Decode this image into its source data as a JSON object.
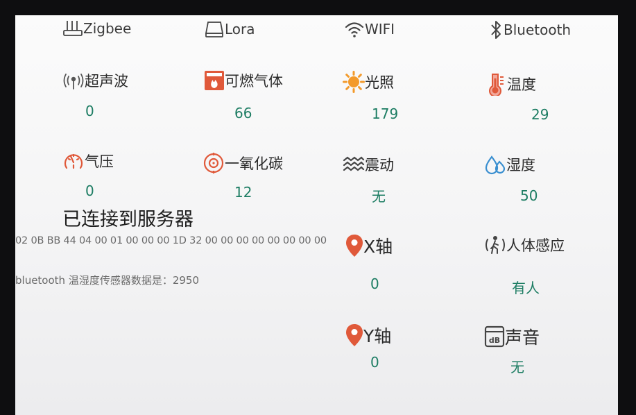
{
  "colors": {
    "accent_value": "#1d7d63",
    "icon_red": "#e0593a",
    "icon_orange": "#f39a2b",
    "icon_blue": "#3a8fd0",
    "icon_gray": "#444444"
  },
  "connectivity": {
    "zigbee": {
      "label": "Zigbee",
      "icon": "router-icon"
    },
    "lora": {
      "label": "Lora",
      "icon": "device-icon"
    },
    "wifi": {
      "label": "WIFI",
      "icon": "wifi-icon"
    },
    "bluetooth": {
      "label": "Bluetooth",
      "icon": "bluetooth-icon"
    }
  },
  "sensors": {
    "ultrasonic": {
      "label": "超声波",
      "value": "0",
      "icon": "signal-icon"
    },
    "gas": {
      "label": "可燃气体",
      "value": "66",
      "icon": "flame-icon"
    },
    "light": {
      "label": "光照",
      "value": "179",
      "icon": "sun-icon"
    },
    "temperature": {
      "label": "温度",
      "value": "29",
      "icon": "thermometer-icon"
    },
    "pressure": {
      "label": "气压",
      "value": "0",
      "icon": "gauge-icon"
    },
    "co": {
      "label": "一氧化碳",
      "value": "12",
      "icon": "target-icon"
    },
    "vibration": {
      "label": "震动",
      "value": "无",
      "icon": "wave-icon"
    },
    "humidity": {
      "label": "湿度",
      "value": "50",
      "icon": "droplet-icon"
    },
    "x_axis": {
      "label": "X轴",
      "value": "0",
      "icon": "location-pin-icon"
    },
    "presence": {
      "label": "人体感应",
      "value": "有人",
      "icon": "person-icon"
    },
    "y_axis": {
      "label": "Y轴",
      "value": "0",
      "icon": "location-pin-icon"
    },
    "sound": {
      "label": "声音",
      "value": "无",
      "icon": "db-icon"
    }
  },
  "status": {
    "title": "已连接到服务器",
    "hex_data": "02 0B BB 44 04 00 01 00 00 00 1D 32 00 00 00 00 00 00 00 00",
    "bluetooth_message": "bluetooth   温湿度传感器数据是：2950"
  }
}
